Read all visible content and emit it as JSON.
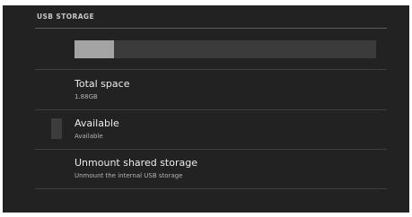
{
  "section": {
    "title": "USB STORAGE"
  },
  "usage_bar": {
    "used_fraction": 0.13,
    "fill_color": "#a4a4a4",
    "track_color": "#3b3b3b"
  },
  "items": [
    {
      "title": "Total space",
      "summary": "1.88GB"
    },
    {
      "title": "Available",
      "summary": "Available",
      "swatch_color": "#3c3c3c"
    },
    {
      "title": "Unmount shared storage",
      "summary": "Unmount the internal USB storage"
    }
  ]
}
